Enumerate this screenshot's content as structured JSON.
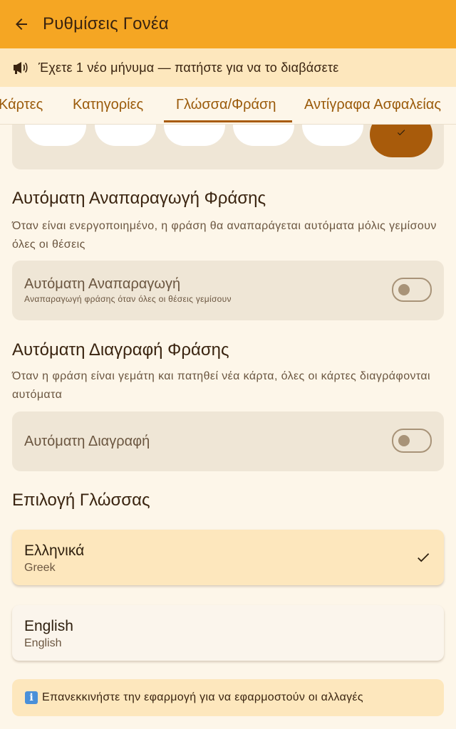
{
  "app_bar": {
    "title": "Ρυθμίσεις Γονέα",
    "back_icon": "arrow-left-icon",
    "color": "#f5a623"
  },
  "banner": {
    "text": "Έχετε 1 νέο μήνυμα — πατήστε για να το διαβάσετε",
    "icon": "megaphone-icon"
  },
  "tabs": [
    {
      "label": "Κάρτες",
      "active": false
    },
    {
      "label": "Κατηγορίες",
      "active": false
    },
    {
      "label": "Γλώσσα/Φράση",
      "active": true
    },
    {
      "label": "Αντίγραφα Ασφαλείας",
      "active": false
    }
  ],
  "auto_play": {
    "title": "Αυτόματη Αναπαραγωγή Φράσης",
    "description": "Όταν είναι ενεργοποιημένο, η φράση θα αναπαράγεται αυτόματα μόλις γεμίσουν όλες οι θέσεις",
    "toggle_label": "Αυτόματη Αναπαραγωγή",
    "toggle_sub": "Αναπαραγωγή φράσης όταν όλες οι θέσεις γεμίσουν",
    "enabled": false
  },
  "auto_clear": {
    "title": "Αυτόματη Διαγραφή Φράσης",
    "description": "Όταν η φράση είναι γεμάτη και πατηθεί νέα κάρτα, όλες οι κάρτες διαγράφονται αυτόματα",
    "toggle_label": "Αυτόματη Διαγραφή",
    "enabled": false
  },
  "language": {
    "title": "Επιλογή Γλώσσας",
    "options": [
      {
        "name": "Ελληνικά",
        "native": "Greek",
        "selected": true
      },
      {
        "name": "English",
        "native": "English",
        "selected": false
      }
    ]
  },
  "info": {
    "icon": "info-icon",
    "icon_glyph": "i",
    "text": "Επανεκκινήστε την εφαρμογή για να εφαρμοστούν οι αλλαγές"
  },
  "colors": {
    "accent": "#f5a623",
    "selected_card": "#fde7bd",
    "brown": "#a85b0b"
  }
}
